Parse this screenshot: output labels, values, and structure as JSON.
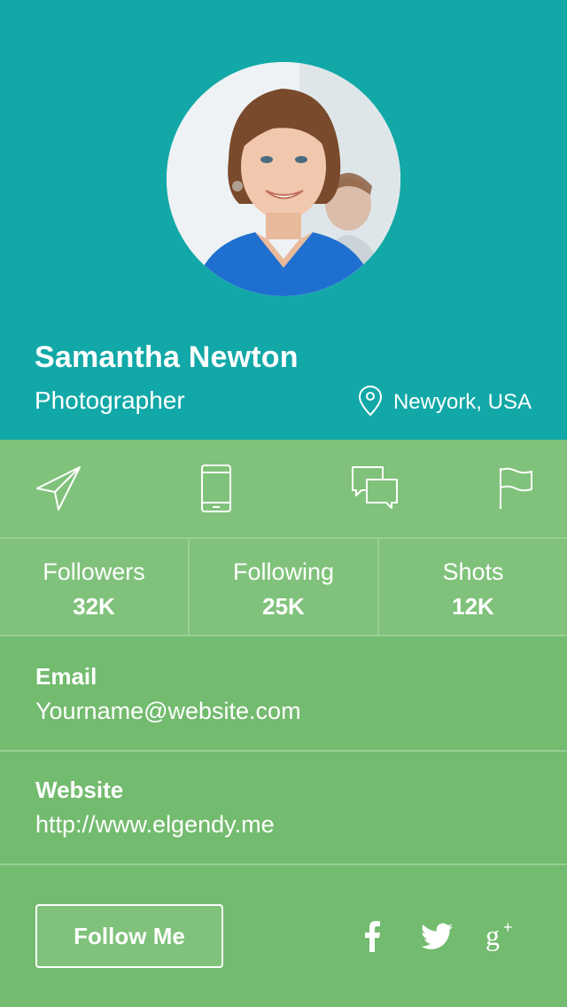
{
  "profile": {
    "name": "Samantha Newton",
    "role": "Photographer",
    "location": "Newyork, USA"
  },
  "actions": [
    {
      "icon": "send-icon"
    },
    {
      "icon": "phone-icon"
    },
    {
      "icon": "chat-icon"
    },
    {
      "icon": "flag-icon"
    }
  ],
  "stats": [
    {
      "label": "Followers",
      "value": "32K"
    },
    {
      "label": "Following",
      "value": "25K"
    },
    {
      "label": "Shots",
      "value": "12K"
    }
  ],
  "contact": {
    "email_label": "Email",
    "email_value": "Yourname@website.com",
    "website_label": "Website",
    "website_value": "http://www.elgendy.me"
  },
  "footer": {
    "follow_label": "Follow Me",
    "social": [
      "facebook-icon",
      "twitter-icon",
      "google-plus-icon"
    ]
  },
  "colors": {
    "header": "#12a8a8",
    "panel_light": "#80c27b",
    "panel": "#73bb6f",
    "divider": "#98cf94"
  }
}
